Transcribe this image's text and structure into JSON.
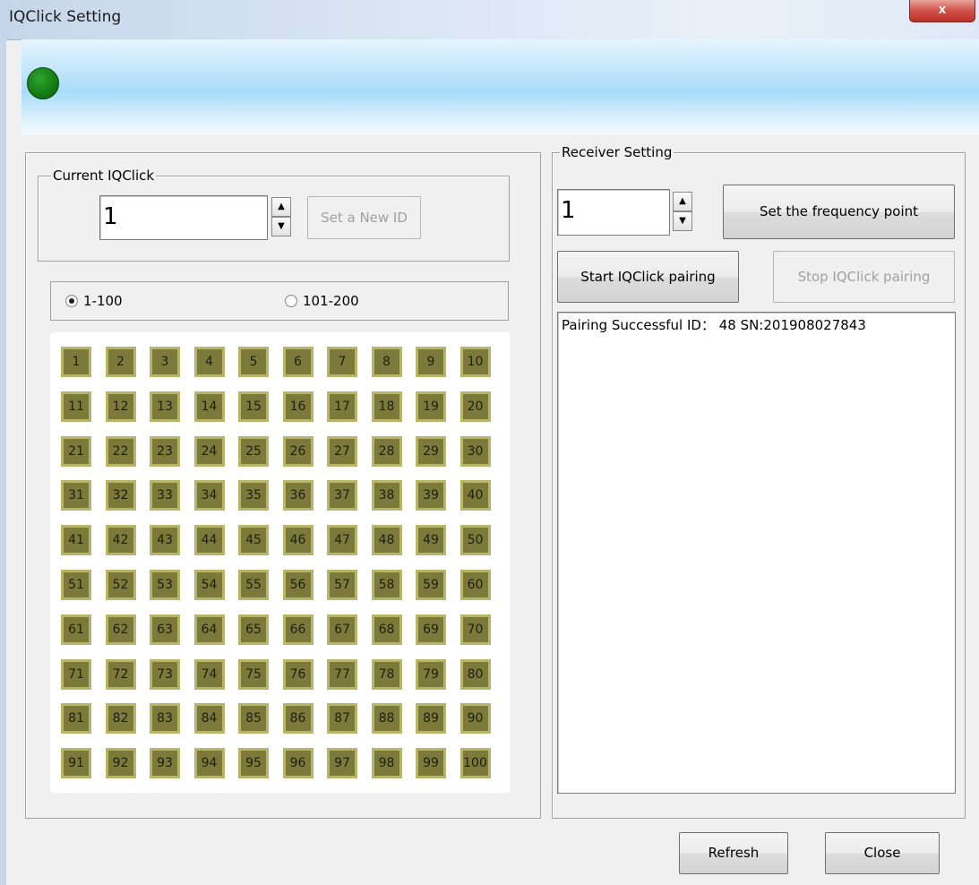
{
  "window": {
    "title": "IQClick Setting",
    "close_glyph": "x",
    "status_color": "#1a8c1a"
  },
  "current": {
    "legend": "Current IQClick",
    "id_value": "1",
    "set_button": "Set a New ID"
  },
  "range": {
    "option1": "1-100",
    "option2": "101-200",
    "selected": "1-100"
  },
  "grid": {
    "cells": [
      "1",
      "2",
      "3",
      "4",
      "5",
      "6",
      "7",
      "8",
      "9",
      "10",
      "11",
      "12",
      "13",
      "14",
      "15",
      "16",
      "17",
      "18",
      "19",
      "20",
      "21",
      "22",
      "23",
      "24",
      "25",
      "26",
      "27",
      "28",
      "29",
      "30",
      "31",
      "32",
      "33",
      "34",
      "35",
      "36",
      "37",
      "38",
      "39",
      "40",
      "41",
      "42",
      "43",
      "44",
      "45",
      "46",
      "47",
      "48",
      "49",
      "50",
      "51",
      "52",
      "53",
      "54",
      "55",
      "56",
      "57",
      "58",
      "59",
      "60",
      "61",
      "62",
      "63",
      "64",
      "65",
      "66",
      "67",
      "68",
      "69",
      "70",
      "71",
      "72",
      "73",
      "74",
      "75",
      "76",
      "77",
      "78",
      "79",
      "80",
      "81",
      "82",
      "83",
      "84",
      "85",
      "86",
      "87",
      "88",
      "89",
      "90",
      "91",
      "92",
      "93",
      "94",
      "95",
      "96",
      "97",
      "98",
      "99",
      "100"
    ],
    "cell_color": "#7b7a3b",
    "cell_border_color": "#b8b569"
  },
  "receiver": {
    "legend": "Receiver Setting",
    "freq_value": "1",
    "set_freq_button": "Set the frequency point",
    "start_button": "Start IQClick pairing",
    "stop_button": "Stop IQClick pairing",
    "log_text": "Pairing Successful ID： 48 SN:201908027843"
  },
  "footer": {
    "refresh_button": "Refresh",
    "close_button": "Close"
  }
}
